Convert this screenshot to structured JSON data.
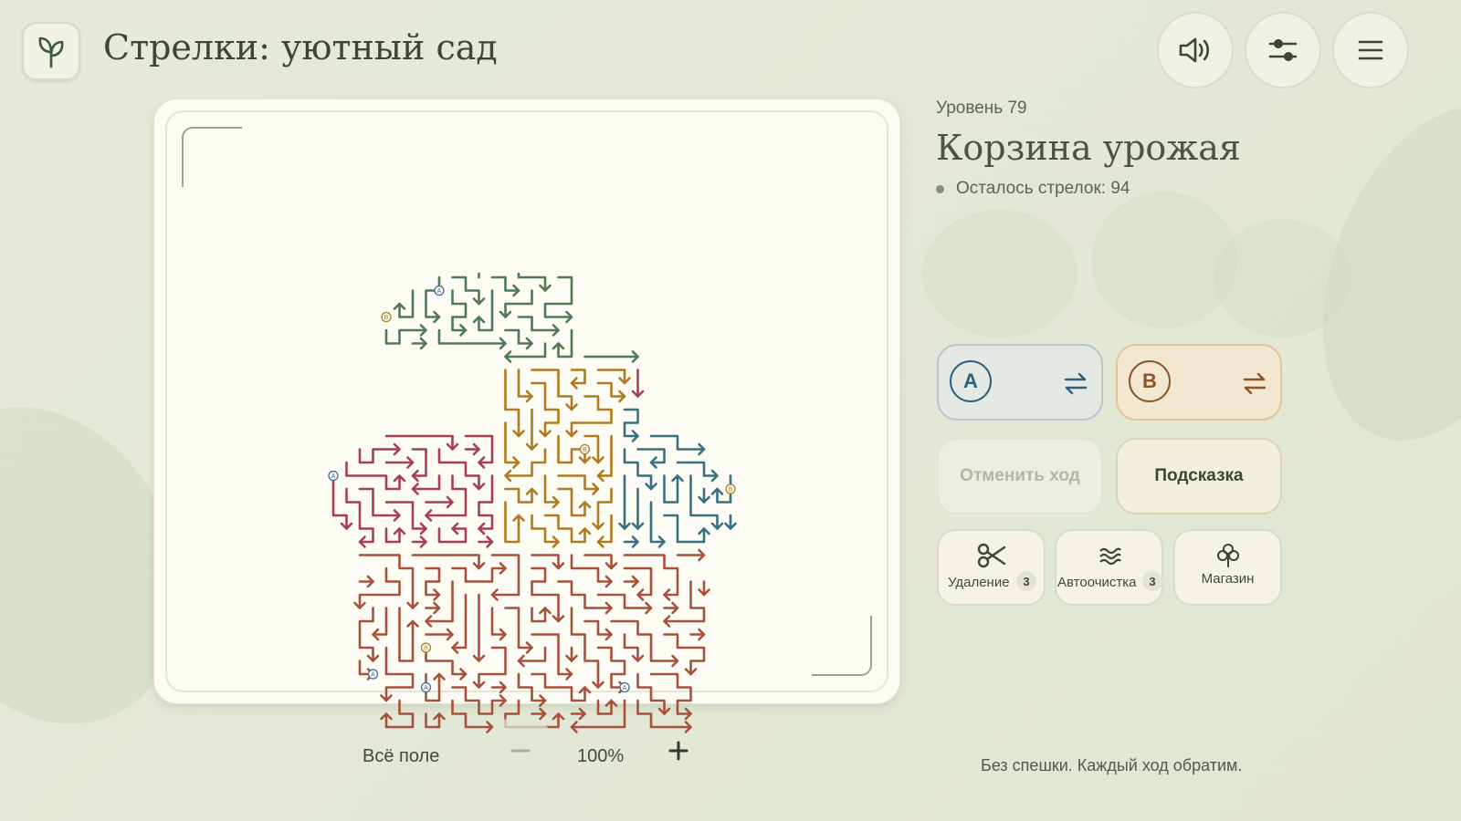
{
  "header": {
    "title": "Стрелки: уютный сад",
    "logo_icon": "sprout-icon",
    "buttons": [
      {
        "name": "sound-button",
        "icon": "speaker-icon"
      },
      {
        "name": "settings-button",
        "icon": "sliders-icon"
      },
      {
        "name": "menu-button",
        "icon": "hamburger-icon"
      }
    ]
  },
  "level": {
    "label": "Уровень 79",
    "name": "Корзина урожая",
    "remaining": "Осталось стрелок: 94"
  },
  "modes": {
    "a": {
      "letter": "A",
      "color": "#2f5f7e"
    },
    "b": {
      "letter": "B",
      "color": "#8a5527"
    }
  },
  "actions": {
    "undo": "Отменить ход",
    "hint": "Подсказка"
  },
  "tools": {
    "remove": {
      "label": "Удаление",
      "count": "3",
      "icon": "scissors-icon"
    },
    "autoclean": {
      "label": "Автоочистка",
      "count": "3",
      "icon": "waves-icon"
    },
    "shop": {
      "label": "Магазин",
      "icon": "clover-icon"
    }
  },
  "zoom": {
    "fit_label": "Всё поле",
    "value": "100%"
  },
  "footer": {
    "note": "Без спешки. Каждый ход обратим."
  },
  "colors": {
    "green": "#4f7a55",
    "gold": "#b07a1e",
    "teal": "#3a6f82",
    "raspberry": "#a83d58",
    "terracotta": "#a8503c",
    "blue": "#3b6d99"
  }
}
